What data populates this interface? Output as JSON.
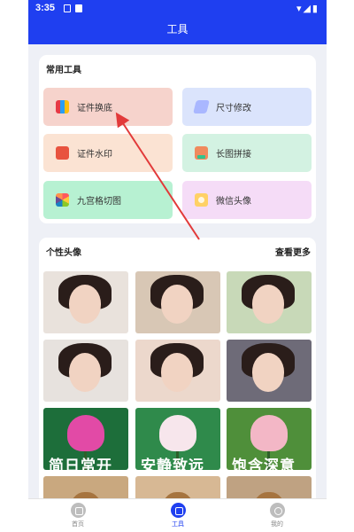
{
  "status_bar": {
    "time": "3:35",
    "right_icons": "▾◢▮"
  },
  "app_bar": {
    "title": "工具"
  },
  "tools_section": {
    "title": "常用工具",
    "items": [
      {
        "label": "证件换底",
        "icon": "id-photo-background-icon"
      },
      {
        "label": "尺寸修改",
        "icon": "resize-icon"
      },
      {
        "label": "证件水印",
        "icon": "watermark-icon"
      },
      {
        "label": "长图拼接",
        "icon": "long-image-stitch-icon"
      },
      {
        "label": "九宫格切图",
        "icon": "grid-cut-icon"
      },
      {
        "label": "微信头像",
        "icon": "wechat-avatar-icon"
      }
    ]
  },
  "avatar_section": {
    "title": "个性头像",
    "more_label": "查看更多",
    "overlay_texts": [
      "简日常开",
      "安静致远",
      "饱含深意"
    ]
  },
  "bottom_nav": {
    "items": [
      {
        "label": "首页",
        "icon": "home-icon"
      },
      {
        "label": "工具",
        "icon": "toolbox-icon"
      },
      {
        "label": "我的",
        "icon": "profile-icon"
      }
    ],
    "active_index": 1
  },
  "colors": {
    "primary": "#1f3ff0",
    "annotation_arrow": "#e23a3a"
  }
}
